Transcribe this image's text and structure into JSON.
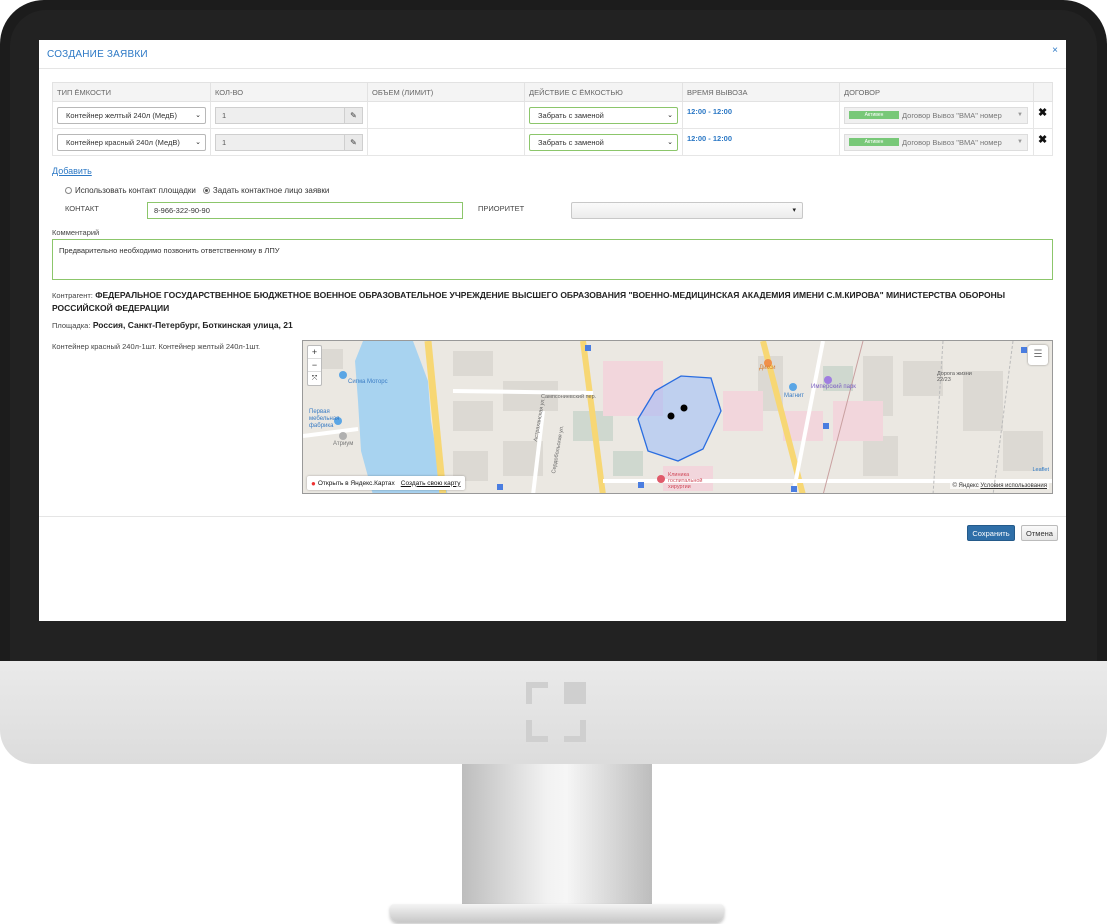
{
  "dialog": {
    "title": "СОЗДАНИЕ ЗАЯВКИ",
    "close_icon": "×"
  },
  "table": {
    "headers": [
      "ТИП ЁМКОСТИ",
      "КОЛ-ВО",
      "ОБЪЕМ (ЛИМИТ)",
      "ДЕЙСТВИЕ С ЁМКОСТЬЮ",
      "ВРЕМЯ ВЫВОЗА",
      "ДОГОВОР"
    ],
    "rows": [
      {
        "type": "Контейнер желтый 240л (МедБ)",
        "qty": "1",
        "action": "Забрать с заменой",
        "time": "12:00 - 12:00",
        "badge": "Активен",
        "contract": "Договор Вывоз \"ВМА\" номер"
      },
      {
        "type": "Контейнер красный 240л (МедВ)",
        "qty": "1",
        "action": "Забрать с заменой",
        "time": "12:00 - 12:00",
        "badge": "Активен",
        "contract": "Договор Вывоз \"ВМА\" номер"
      }
    ],
    "remove_icon": "✖"
  },
  "add_link": "Добавить",
  "contact_mode": {
    "option1": "Использовать контакт площадки",
    "option2": "Задать контактное лицо заявки",
    "selected": 2
  },
  "contact": {
    "label": "КОНТАКТ",
    "value": "8-966-322-90-90"
  },
  "priority": {
    "label": "ПРИОРИТЕТ",
    "value": ""
  },
  "comment": {
    "label": "Комментарий",
    "value": "Предварительно необходимо позвонить ответственному в ЛПУ"
  },
  "contractor": {
    "label": "Контрагент:",
    "value": "ФЕДЕРАЛЬНОЕ ГОСУДАРСТВЕННОЕ БЮДЖЕТНОЕ ВОЕННОЕ ОБРАЗОВАТЕЛЬНОЕ УЧРЕЖДЕНИЕ ВЫСШЕГО ОБРАЗОВАНИЯ \"ВОЕННО-МЕДИЦИНСКАЯ АКАДЕМИЯ ИМЕНИ С.М.КИРОВА\" МИНИСТЕРСТВА ОБОРОНЫ РОССИЙСКОЙ ФЕДЕРАЦИИ"
  },
  "site": {
    "label": "Площадка:",
    "value": "Россия, Санкт-Петербург, Боткинская улица, 21"
  },
  "containers_summary": "Контейнер красный 240л-1шт. Контейнер желтый 240л-1шт.",
  "map": {
    "zoom_in": "+",
    "zoom_out": "−",
    "fullscreen": "⤧",
    "open_yandex": "Открыть в Яндекс.Картах",
    "create_map": "Создать свою карту",
    "copyright": "© Яндекс",
    "terms": "Условия использования",
    "leaflet": "Leaflet",
    "labels": {
      "sigma": "Сигма Моторс",
      "fabrika": "Первая мебельная фабрика",
      "atrium": "Атриум",
      "samson": "Сампсониевский пер.",
      "astrakhan": "Астраханская ул.",
      "serdob": "Сердобольская ул.",
      "klinika": "Клиника госпитальной хирургии",
      "dikaya": "Дикси",
      "magnit": "Магнит",
      "imper": "Имперский парк",
      "doroga": "Дорога жизни 22/23",
      "pir": "Пи"
    },
    "colors": {
      "water": "#a8d3f0",
      "polygon_fill": "#8ab4ff",
      "polygon_stroke": "#2a6de0",
      "road": "#f7d774"
    }
  },
  "buttons": {
    "save": "Сохранить",
    "cancel": "Отмена"
  }
}
